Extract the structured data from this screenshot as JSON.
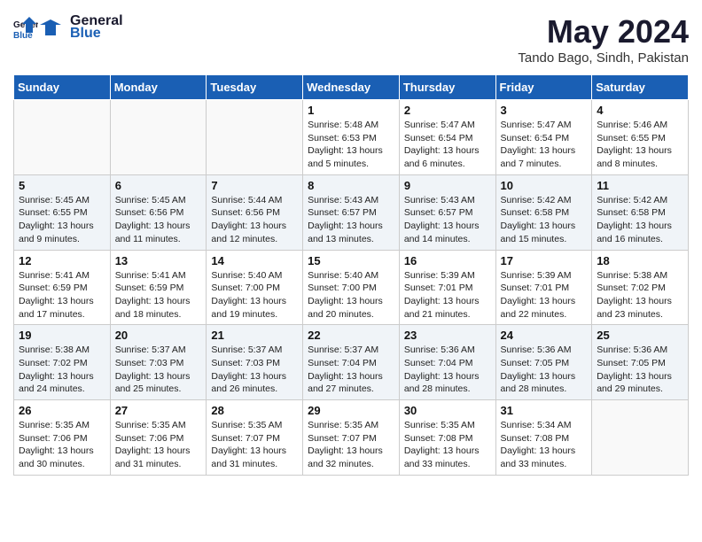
{
  "header": {
    "logo_line1": "General",
    "logo_line2": "Blue",
    "month_title": "May 2024",
    "location": "Tando Bago, Sindh, Pakistan"
  },
  "weekdays": [
    "Sunday",
    "Monday",
    "Tuesday",
    "Wednesday",
    "Thursday",
    "Friday",
    "Saturday"
  ],
  "weeks": [
    [
      {
        "day": "",
        "sunrise": "",
        "sunset": "",
        "daylight": ""
      },
      {
        "day": "",
        "sunrise": "",
        "sunset": "",
        "daylight": ""
      },
      {
        "day": "",
        "sunrise": "",
        "sunset": "",
        "daylight": ""
      },
      {
        "day": "1",
        "sunrise": "Sunrise: 5:48 AM",
        "sunset": "Sunset: 6:53 PM",
        "daylight": "Daylight: 13 hours and 5 minutes."
      },
      {
        "day": "2",
        "sunrise": "Sunrise: 5:47 AM",
        "sunset": "Sunset: 6:54 PM",
        "daylight": "Daylight: 13 hours and 6 minutes."
      },
      {
        "day": "3",
        "sunrise": "Sunrise: 5:47 AM",
        "sunset": "Sunset: 6:54 PM",
        "daylight": "Daylight: 13 hours and 7 minutes."
      },
      {
        "day": "4",
        "sunrise": "Sunrise: 5:46 AM",
        "sunset": "Sunset: 6:55 PM",
        "daylight": "Daylight: 13 hours and 8 minutes."
      }
    ],
    [
      {
        "day": "5",
        "sunrise": "Sunrise: 5:45 AM",
        "sunset": "Sunset: 6:55 PM",
        "daylight": "Daylight: 13 hours and 9 minutes."
      },
      {
        "day": "6",
        "sunrise": "Sunrise: 5:45 AM",
        "sunset": "Sunset: 6:56 PM",
        "daylight": "Daylight: 13 hours and 11 minutes."
      },
      {
        "day": "7",
        "sunrise": "Sunrise: 5:44 AM",
        "sunset": "Sunset: 6:56 PM",
        "daylight": "Daylight: 13 hours and 12 minutes."
      },
      {
        "day": "8",
        "sunrise": "Sunrise: 5:43 AM",
        "sunset": "Sunset: 6:57 PM",
        "daylight": "Daylight: 13 hours and 13 minutes."
      },
      {
        "day": "9",
        "sunrise": "Sunrise: 5:43 AM",
        "sunset": "Sunset: 6:57 PM",
        "daylight": "Daylight: 13 hours and 14 minutes."
      },
      {
        "day": "10",
        "sunrise": "Sunrise: 5:42 AM",
        "sunset": "Sunset: 6:58 PM",
        "daylight": "Daylight: 13 hours and 15 minutes."
      },
      {
        "day": "11",
        "sunrise": "Sunrise: 5:42 AM",
        "sunset": "Sunset: 6:58 PM",
        "daylight": "Daylight: 13 hours and 16 minutes."
      }
    ],
    [
      {
        "day": "12",
        "sunrise": "Sunrise: 5:41 AM",
        "sunset": "Sunset: 6:59 PM",
        "daylight": "Daylight: 13 hours and 17 minutes."
      },
      {
        "day": "13",
        "sunrise": "Sunrise: 5:41 AM",
        "sunset": "Sunset: 6:59 PM",
        "daylight": "Daylight: 13 hours and 18 minutes."
      },
      {
        "day": "14",
        "sunrise": "Sunrise: 5:40 AM",
        "sunset": "Sunset: 7:00 PM",
        "daylight": "Daylight: 13 hours and 19 minutes."
      },
      {
        "day": "15",
        "sunrise": "Sunrise: 5:40 AM",
        "sunset": "Sunset: 7:00 PM",
        "daylight": "Daylight: 13 hours and 20 minutes."
      },
      {
        "day": "16",
        "sunrise": "Sunrise: 5:39 AM",
        "sunset": "Sunset: 7:01 PM",
        "daylight": "Daylight: 13 hours and 21 minutes."
      },
      {
        "day": "17",
        "sunrise": "Sunrise: 5:39 AM",
        "sunset": "Sunset: 7:01 PM",
        "daylight": "Daylight: 13 hours and 22 minutes."
      },
      {
        "day": "18",
        "sunrise": "Sunrise: 5:38 AM",
        "sunset": "Sunset: 7:02 PM",
        "daylight": "Daylight: 13 hours and 23 minutes."
      }
    ],
    [
      {
        "day": "19",
        "sunrise": "Sunrise: 5:38 AM",
        "sunset": "Sunset: 7:02 PM",
        "daylight": "Daylight: 13 hours and 24 minutes."
      },
      {
        "day": "20",
        "sunrise": "Sunrise: 5:37 AM",
        "sunset": "Sunset: 7:03 PM",
        "daylight": "Daylight: 13 hours and 25 minutes."
      },
      {
        "day": "21",
        "sunrise": "Sunrise: 5:37 AM",
        "sunset": "Sunset: 7:03 PM",
        "daylight": "Daylight: 13 hours and 26 minutes."
      },
      {
        "day": "22",
        "sunrise": "Sunrise: 5:37 AM",
        "sunset": "Sunset: 7:04 PM",
        "daylight": "Daylight: 13 hours and 27 minutes."
      },
      {
        "day": "23",
        "sunrise": "Sunrise: 5:36 AM",
        "sunset": "Sunset: 7:04 PM",
        "daylight": "Daylight: 13 hours and 28 minutes."
      },
      {
        "day": "24",
        "sunrise": "Sunrise: 5:36 AM",
        "sunset": "Sunset: 7:05 PM",
        "daylight": "Daylight: 13 hours and 28 minutes."
      },
      {
        "day": "25",
        "sunrise": "Sunrise: 5:36 AM",
        "sunset": "Sunset: 7:05 PM",
        "daylight": "Daylight: 13 hours and 29 minutes."
      }
    ],
    [
      {
        "day": "26",
        "sunrise": "Sunrise: 5:35 AM",
        "sunset": "Sunset: 7:06 PM",
        "daylight": "Daylight: 13 hours and 30 minutes."
      },
      {
        "day": "27",
        "sunrise": "Sunrise: 5:35 AM",
        "sunset": "Sunset: 7:06 PM",
        "daylight": "Daylight: 13 hours and 31 minutes."
      },
      {
        "day": "28",
        "sunrise": "Sunrise: 5:35 AM",
        "sunset": "Sunset: 7:07 PM",
        "daylight": "Daylight: 13 hours and 31 minutes."
      },
      {
        "day": "29",
        "sunrise": "Sunrise: 5:35 AM",
        "sunset": "Sunset: 7:07 PM",
        "daylight": "Daylight: 13 hours and 32 minutes."
      },
      {
        "day": "30",
        "sunrise": "Sunrise: 5:35 AM",
        "sunset": "Sunset: 7:08 PM",
        "daylight": "Daylight: 13 hours and 33 minutes."
      },
      {
        "day": "31",
        "sunrise": "Sunrise: 5:34 AM",
        "sunset": "Sunset: 7:08 PM",
        "daylight": "Daylight: 13 hours and 33 minutes."
      },
      {
        "day": "",
        "sunrise": "",
        "sunset": "",
        "daylight": ""
      }
    ]
  ]
}
